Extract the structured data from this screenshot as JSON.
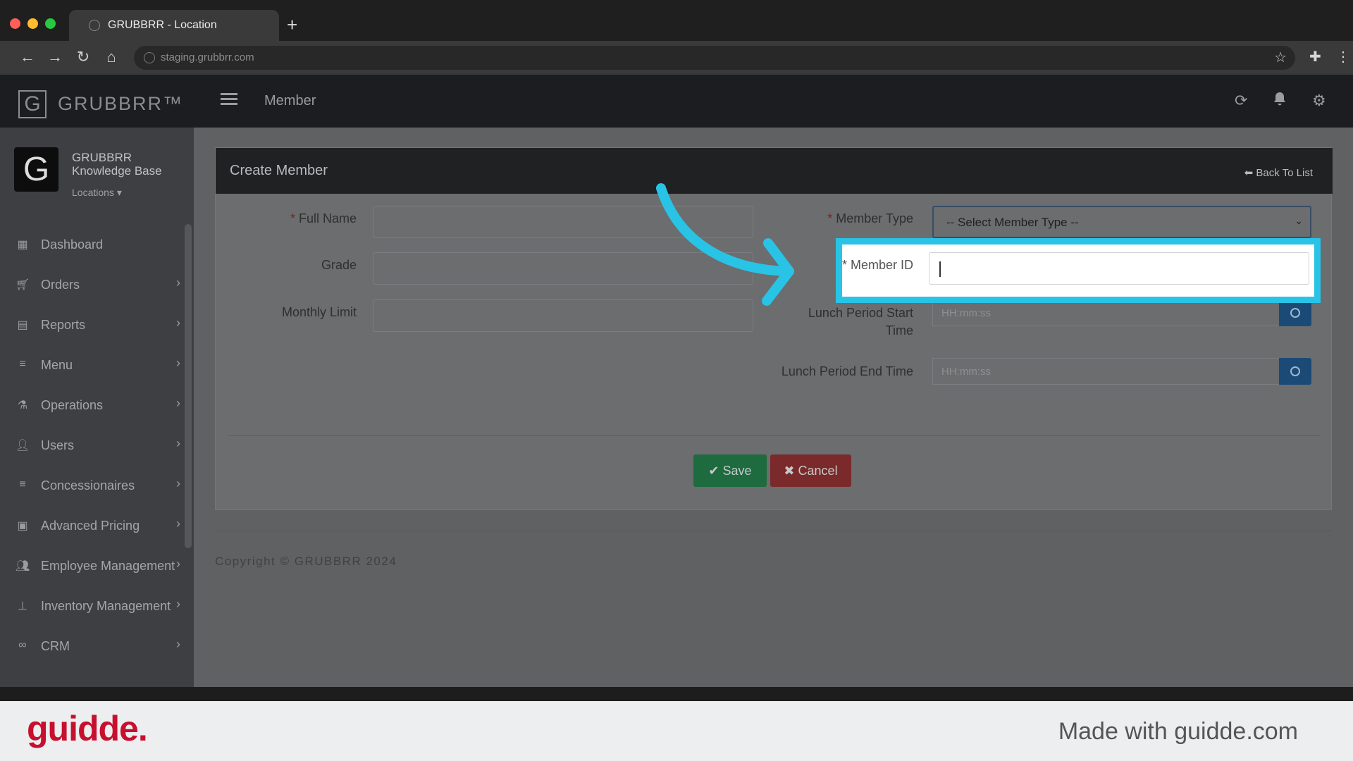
{
  "browser": {
    "tab_title": "GRUBBRR - Location",
    "url": "staging.grubbrr.com",
    "new_tab_label": "+"
  },
  "app": {
    "logo_letter": "G",
    "logo_text": "GRUBBRR™",
    "header_title": "Member",
    "brand_name": "GRUBBRR Knowledge Base",
    "locations_label": "Locations"
  },
  "sidebar": {
    "items": [
      {
        "label": "Dashboard",
        "icon": "dashboard-icon",
        "has_chevron": false
      },
      {
        "label": "Orders",
        "icon": "cart-icon",
        "has_chevron": true
      },
      {
        "label": "Reports",
        "icon": "document-icon",
        "has_chevron": true
      },
      {
        "label": "Menu",
        "icon": "list-icon",
        "has_chevron": true
      },
      {
        "label": "Operations",
        "icon": "flask-icon",
        "has_chevron": true
      },
      {
        "label": "Users",
        "icon": "user-plus-icon",
        "has_chevron": true
      },
      {
        "label": "Concessionaires",
        "icon": "list-icon",
        "has_chevron": true
      },
      {
        "label": "Advanced Pricing",
        "icon": "money-icon",
        "has_chevron": true
      },
      {
        "label": "Employee Management",
        "icon": "users-icon",
        "has_chevron": true
      },
      {
        "label": "Inventory Management",
        "icon": "sitemap-icon",
        "has_chevron": true
      },
      {
        "label": "CRM",
        "icon": "link-icon",
        "has_chevron": true
      }
    ]
  },
  "form": {
    "title": "Create Member",
    "back_link": "Back To List",
    "required_mark": "*",
    "full_name_label": "Full Name",
    "grade_label": "Grade",
    "monthly_limit_label": "Monthly Limit",
    "member_type_label": "Member Type",
    "member_type_value": "-- Select Member Type --",
    "member_id_label": "Member ID",
    "lunch_start_label": "Lunch Period Start Time",
    "lunch_end_label": "Lunch Period End Time",
    "time_placeholder": "HH:mm:ss",
    "save_label": "Save",
    "cancel_label": "Cancel"
  },
  "footer": {
    "copyright": "Copyright © GRUBBRR 2024"
  },
  "watermark": {
    "logo": "guidde.",
    "made_with": "Made with guidde.com"
  },
  "colors": {
    "highlight": "#29c3e6",
    "save": "#1d6b3f",
    "cancel": "#7a2a2a",
    "brand_red": "#c8102e"
  }
}
